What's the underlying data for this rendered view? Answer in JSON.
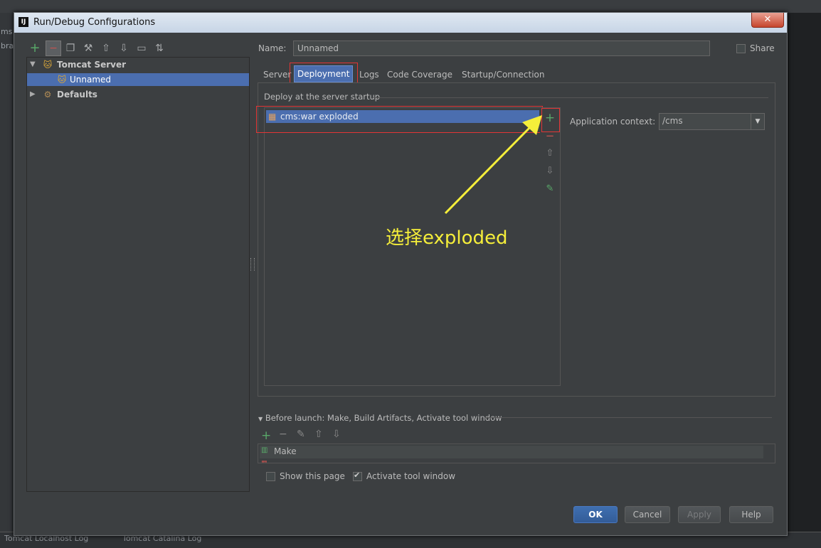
{
  "background": {
    "left_fragments": [
      "ms",
      "bra"
    ],
    "bottom_tabs": [
      "Tomcat Localhost Log",
      "Tomcat Catalina Log"
    ]
  },
  "dialog": {
    "title": "Run/Debug Configurations",
    "app_icon_text": "IJ",
    "close_label": "✕"
  },
  "tree": {
    "nodes": [
      {
        "label": "Tomcat Server",
        "expanded": true
      },
      {
        "label": "Unnamed",
        "selected": true
      },
      {
        "label": "Defaults",
        "expanded": false
      }
    ]
  },
  "form": {
    "name_label": "Name:",
    "name_value": "Unnamed",
    "share_label": "Share",
    "share_checked": false
  },
  "tabs": [
    {
      "label": "Server"
    },
    {
      "label": "Deployment",
      "active": true
    },
    {
      "label": "Logs"
    },
    {
      "label": "Code Coverage"
    },
    {
      "label": "Startup/Connection"
    }
  ],
  "deployment": {
    "group_title": "Deploy at the server startup",
    "items": [
      "cms:war exploded"
    ],
    "app_context_label": "Application context:",
    "app_context_value": "/cms"
  },
  "annotation": {
    "text": "选择exploded",
    "color": "#f5ee3a",
    "box_color": "#e23535"
  },
  "before_launch": {
    "title": "Before launch: Make, Build Artifacts, Activate tool window",
    "items": [
      "Make"
    ]
  },
  "options": {
    "show_page_label": "Show this page",
    "show_page_checked": false,
    "activate_label": "Activate tool window",
    "activate_checked": true
  },
  "buttons": {
    "ok": "OK",
    "cancel": "Cancel",
    "apply": "Apply",
    "help": "Help"
  },
  "colors": {
    "selection": "#4b6eaf",
    "add_green": "#59a869",
    "remove_red": "#c75450"
  }
}
